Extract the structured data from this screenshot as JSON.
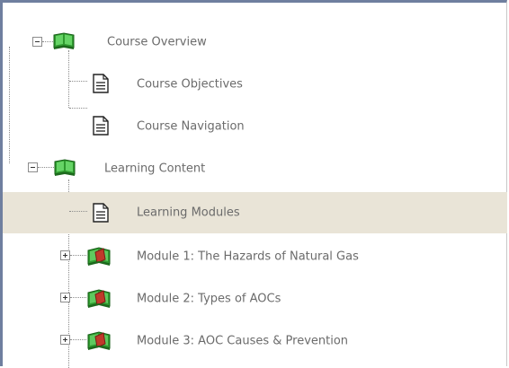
{
  "tree": {
    "nodes": [
      {
        "label": "Course Overview",
        "icon": "book-icon",
        "expanded": true
      },
      {
        "label": "Course Objectives",
        "icon": "document-icon"
      },
      {
        "label": "Course Navigation",
        "icon": "document-icon"
      },
      {
        "label": "Learning Content",
        "icon": "book-icon",
        "expanded": true
      },
      {
        "label": "Learning Modules",
        "icon": "document-icon",
        "selected": true
      },
      {
        "label": "Module 1: The Hazards of Natural Gas",
        "icon": "module-book-icon",
        "expanded": false
      },
      {
        "label": "Module 2: Types of AOCs",
        "icon": "module-book-icon",
        "expanded": false
      },
      {
        "label": "Module 3: AOC Causes & Prevention",
        "icon": "module-book-icon",
        "expanded": false
      }
    ]
  },
  "colors": {
    "selected_row": "#e9e4d7",
    "label_text": "#6b6b6b",
    "book_green": "#2f9a2f",
    "module_red": "#c0392b"
  }
}
